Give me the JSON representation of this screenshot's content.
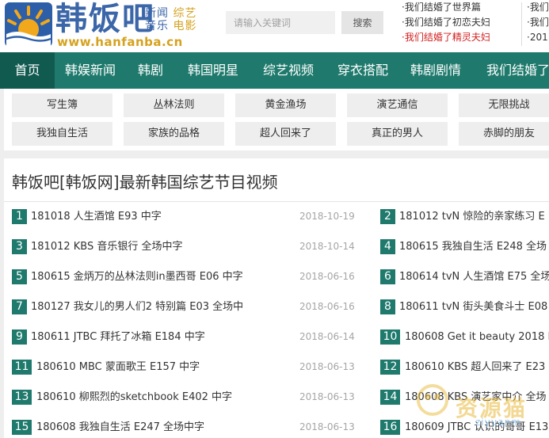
{
  "header": {
    "brand": "韩饭吧",
    "tag_line1_a": "新闻",
    "tag_line1_b": "综艺",
    "tag_line2_a": "音乐",
    "tag_line2_b": "电影",
    "url": "www.hanfanba.cn",
    "search_placeholder": "请输入关键词",
    "search_button": "搜索",
    "news_col1": [
      "·我们结婚了世界篇",
      "·我们结婚了初恋夫妇",
      "·我们结婚了精灵夫妇"
    ],
    "news_col2": [
      "·我们",
      "·我们",
      "·201"
    ]
  },
  "nav": [
    "首页",
    "韩娱新闻",
    "韩剧",
    "韩国明星",
    "综艺视频",
    "穿衣搭配",
    "韩剧剧情",
    "我们结婚了"
  ],
  "subnav": [
    [
      "写生簿",
      "丛林法则",
      "黄金渔场",
      "演艺通信",
      "无限挑战"
    ],
    [
      "我独自生活",
      "家族的品格",
      "超人回来了",
      "真正的男人",
      "赤脚的朋友"
    ]
  ],
  "main": {
    "title": "韩饭吧[韩饭网]最新韩国综艺节目视频",
    "left": [
      {
        "num": "1",
        "title": "181018 人生酒馆 E93 中字",
        "date": "2018-10-19"
      },
      {
        "num": "3",
        "title": "181012 KBS 音乐银行 全场中字",
        "date": "2018-10-14"
      },
      {
        "num": "5",
        "title": "180615 金炳万的丛林法则in墨西哥 E06 中字",
        "date": "2018-06-16"
      },
      {
        "num": "7",
        "title": "180127 我女儿的男人们2 特别篇 E03 全场中",
        "date": "2018-06-16"
      },
      {
        "num": "9",
        "title": "180611 JTBC 拜托了冰箱 E184 中字",
        "date": "2018-06-14"
      },
      {
        "num": "11",
        "title": "180610 MBC 蒙面歌王 E157 中字",
        "date": "2018-06-13"
      },
      {
        "num": "13",
        "title": "180610 柳熙烈的sketchbook E402 中字",
        "date": "2018-06-13"
      },
      {
        "num": "15",
        "title": "180608 我独自生活 E247 全场中字",
        "date": "2018-06-13"
      }
    ],
    "right": [
      {
        "num": "2",
        "title": "181012 tvN 惊险的亲家练习 E"
      },
      {
        "num": "4",
        "title": "180615 我独自生活 E248 全场"
      },
      {
        "num": "6",
        "title": "180614 tvN 人生酒馆 E75 全场"
      },
      {
        "num": "8",
        "title": "180611 tvN 街头美食斗士 E08"
      },
      {
        "num": "10",
        "title": "180608 Get it beauty 2018 E"
      },
      {
        "num": "12",
        "title": "180610 KBS 超人回来了 E23"
      },
      {
        "num": "14",
        "title": "180608 KBS 演艺家中介 全场"
      },
      {
        "num": "16",
        "title": "180609 JTBC 认识的哥哥 E13"
      }
    ]
  },
  "watermark": {
    "text": "资源猫",
    "sub": "ziyuanm"
  }
}
